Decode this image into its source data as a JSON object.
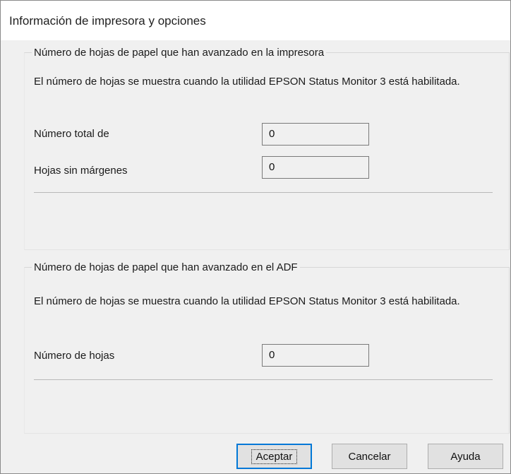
{
  "window": {
    "title": "Información de impresora y opciones"
  },
  "printer_group": {
    "legend": "Número de hojas de papel que han avanzado en la impresora",
    "note": "El número de hojas se muestra cuando la utilidad EPSON Status Monitor 3 está habilitada.",
    "fields": [
      {
        "label": "Número total de",
        "value": "0"
      },
      {
        "label": "Hojas sin márgenes",
        "value": "0"
      }
    ]
  },
  "adf_group": {
    "legend": "Número de hojas de papel que han avanzado en el ADF",
    "note": "El número de hojas se muestra cuando la utilidad EPSON Status Monitor 3 está habilitada.",
    "fields": [
      {
        "label": "Número de hojas",
        "value": "0"
      }
    ]
  },
  "buttons": {
    "ok": "Aceptar",
    "cancel": "Cancelar",
    "help": "Ayuda"
  }
}
